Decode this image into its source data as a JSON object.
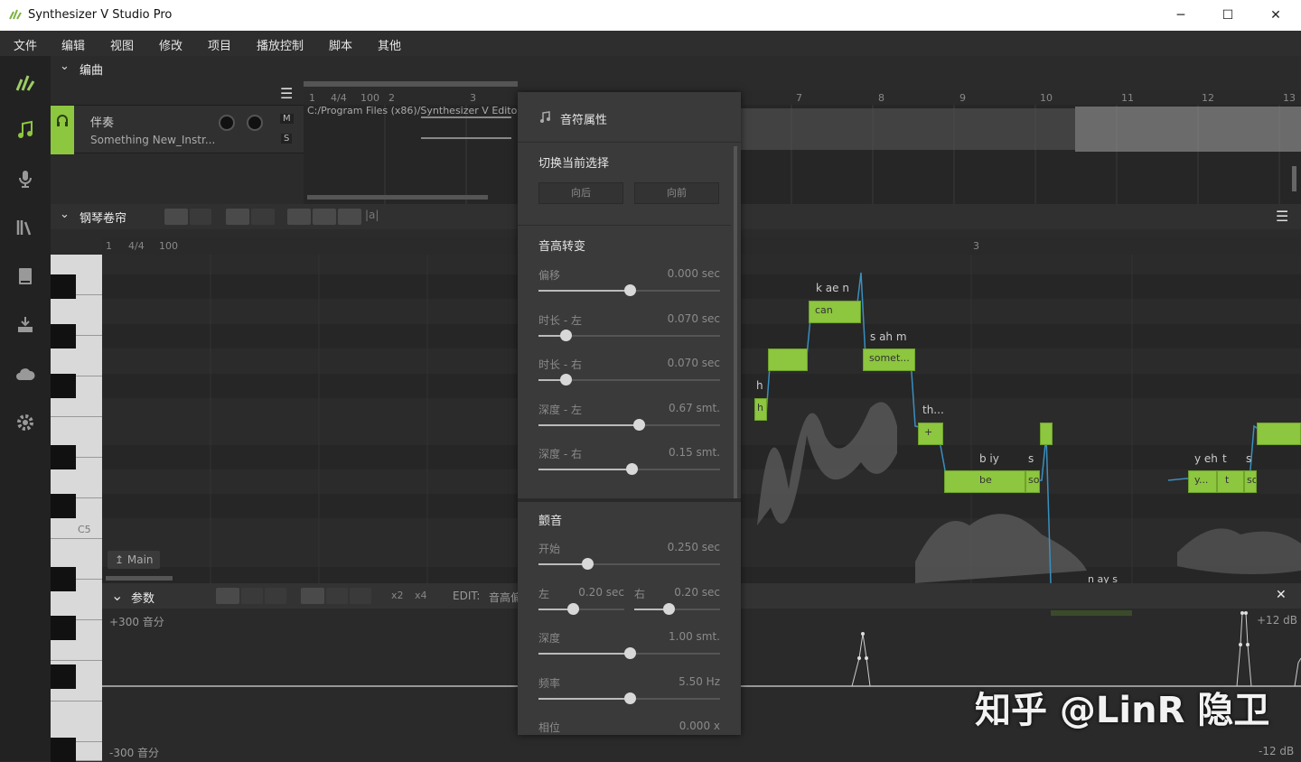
{
  "window": {
    "title": "Synthesizer V Studio Pro",
    "minimize": "─",
    "maximize": "☐",
    "close": "✕"
  },
  "menu": [
    "文件",
    "编辑",
    "视图",
    "修改",
    "项目",
    "播放控制",
    "脚本",
    "其他"
  ],
  "sidebar": [
    "logo-icon",
    "note-icon",
    "microphone-icon",
    "library-icon",
    "book-icon",
    "export-icon",
    "cloud-icon",
    "gear-icon"
  ],
  "arrangement": {
    "title": "编曲",
    "ruler": [
      "1",
      "4/4",
      "100",
      "2",
      "3",
      "7",
      "8",
      "9",
      "10",
      "11",
      "12",
      "13"
    ],
    "track": {
      "name": "伴奏",
      "file": "Something New_Instr...",
      "mute": "M",
      "solo": "S",
      "path": "C:/Program Files (x86)/Synthesizer V Editor"
    }
  },
  "pianoroll": {
    "title": "钢琴卷帘",
    "ruler": [
      "1",
      "4/4",
      "100",
      "3"
    ],
    "tool_text": "|a|",
    "key_c5": "C5",
    "group_button": "Main",
    "notes": [
      {
        "lyric": "can",
        "phoneme": "k ae n"
      },
      {
        "lyric": "",
        "phoneme": ""
      },
      {
        "lyric": "somet...",
        "phoneme": "s ah m"
      },
      {
        "lyric": "h",
        "phoneme": "h"
      },
      {
        "lyric": "+",
        "phoneme": "th..."
      },
      {
        "lyric": "be",
        "phoneme": "b iy"
      },
      {
        "lyric": "so",
        "phoneme": "s"
      },
      {
        "lyric": "",
        "phoneme": ""
      },
      {
        "lyric": "y...",
        "phoneme": "y eh"
      },
      {
        "lyric": "t",
        "phoneme": "t"
      },
      {
        "lyric": "so",
        "phoneme": "s"
      },
      {
        "lyric": "",
        "phoneme": ""
      },
      {
        "lyric": "",
        "phoneme": "n ay s"
      }
    ]
  },
  "params": {
    "title": "参数",
    "x2": "x2",
    "x4": "x4",
    "edit": "EDIT:",
    "edit_target": "音高偏",
    "top": "+300 音分",
    "bottom": "-300 音分",
    "db_top": "+12 dB",
    "db_bottom": "-12 dB"
  },
  "panel": {
    "title": "音符属性",
    "switch": {
      "title": "切换当前选择",
      "back": "向后",
      "forward": "向前"
    },
    "pitch": {
      "title": "音高转变",
      "rows": [
        {
          "label": "偏移",
          "value": "0.000 sec",
          "pos": 0.5
        },
        {
          "label": "时长 - 左",
          "value": "0.070 sec",
          "pos": 0.15
        },
        {
          "label": "时长 - 右",
          "value": "0.070 sec",
          "pos": 0.15
        },
        {
          "label": "深度 - 左",
          "value": "0.67 smt.",
          "pos": 0.55
        },
        {
          "label": "深度 - 右",
          "value": "0.15 smt.",
          "pos": 0.51
        }
      ]
    },
    "vibrato": {
      "title": "颤音",
      "start": {
        "label": "开始",
        "value": "0.250 sec",
        "pos": 0.27
      },
      "left": {
        "label": "左",
        "value": "0.20 sec",
        "pos": 0.4
      },
      "right": {
        "label": "右",
        "value": "0.20 sec",
        "pos": 0.4
      },
      "rows": [
        {
          "label": "深度",
          "value": "1.00 smt.",
          "pos": 0.5
        },
        {
          "label": "频率",
          "value": "5.50 Hz",
          "pos": 0.5
        },
        {
          "label": "相位",
          "value": "0.000 x",
          "pos": 0.5
        }
      ]
    }
  },
  "watermark": "知乎 @LinR 隐卫",
  "colors": {
    "note": "#8dc63f",
    "track_accent": "#8dc63f",
    "pitch_line": "#3a8fbf"
  }
}
